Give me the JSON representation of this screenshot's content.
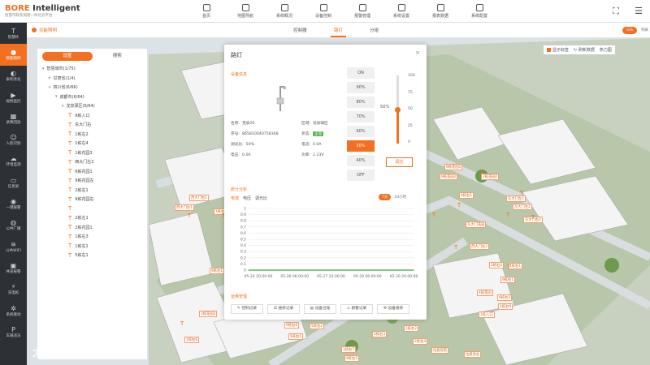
{
  "header": {
    "brand": "BORE",
    "brand2": "Intelligent",
    "subtitle": "智慧市政及照明一体化云平台",
    "nav": [
      "首页",
      "地图导航",
      "系统概况",
      "设备控制",
      "报警管理",
      "系统设置",
      "报表数据",
      "系统配置"
    ]
  },
  "sidebar": [
    {
      "label": "智慧杆",
      "icon": "T"
    },
    {
      "label": "智能照明",
      "icon": "●"
    },
    {
      "label": "泰利亮化",
      "icon": "◐"
    },
    {
      "label": "视频监控",
      "icon": "▶"
    },
    {
      "label": "录像回放",
      "icon": "▦"
    },
    {
      "label": "人脸识别",
      "icon": "☺"
    },
    {
      "label": "环境监测",
      "icon": "☁"
    },
    {
      "label": "信息屏",
      "icon": "▭"
    },
    {
      "label": "一键报警",
      "icon": "◉"
    },
    {
      "label": "公共广播",
      "icon": "◍"
    },
    {
      "label": "公共WIFI",
      "icon": "≋"
    },
    {
      "label": "井盖报警",
      "icon": "▣"
    },
    {
      "label": "充电桩",
      "icon": "⚡"
    },
    {
      "label": "系统联动",
      "icon": "✲"
    },
    {
      "label": "车辆违法",
      "icon": "P"
    }
  ],
  "subheader": {
    "crumb": "功能照明",
    "tabs": [
      "控制器",
      "路灯",
      "分组"
    ],
    "toggle_on": "GIS",
    "toggle_off": "列表"
  },
  "leftpanel": {
    "tabs": [
      "设置",
      "搜索"
    ],
    "tree": [
      {
        "label": "智慧城市(1/75)",
        "level": 0,
        "caret": "▾"
      },
      {
        "label": "甘肃省(1/4)",
        "level": 1,
        "caret": "▸"
      },
      {
        "label": "四川省(6/66)",
        "level": 1,
        "caret": "▾"
      },
      {
        "label": "成都市(6/64)",
        "level": 2,
        "caret": "▾"
      },
      {
        "label": "龙泉驿区(6/64)",
        "level": 3,
        "caret": "▾"
      },
      {
        "label": "9栋入口",
        "level": 4
      },
      {
        "label": "东大门右",
        "level": 4
      },
      {
        "label": "1栋右2",
        "level": 4
      },
      {
        "label": "1栋右4",
        "level": 4
      },
      {
        "label": "1栋花园3",
        "level": 4
      },
      {
        "label": "西大门左2",
        "level": 4
      },
      {
        "label": "6栋花园1",
        "level": 4
      },
      {
        "label": "9栋花园左",
        "level": 4
      },
      {
        "label": "2栋右1",
        "level": 4
      },
      {
        "label": "9栋花园右",
        "level": 4
      },
      {
        "label": "",
        "level": 4
      },
      {
        "label": "2栋左1",
        "level": 4
      },
      {
        "label": "2栋花园1",
        "level": 4
      },
      {
        "label": "1栋右3",
        "level": 4
      },
      {
        "label": "1栋右1",
        "level": 4
      },
      {
        "label": "5栋右1",
        "level": 4
      }
    ]
  },
  "modal": {
    "title": "路灯",
    "close": "×",
    "sec_info": "设备信息",
    "sec_stats": "统计分析",
    "sec_mgmt": "运维管理",
    "info": [
      {
        "k": "名称:",
        "v": "克泉20"
      },
      {
        "k": "区域:",
        "v": "龙泉驿区"
      },
      {
        "k": "序号:",
        "v": "865810040758368"
      },
      {
        "k": "状态:",
        "v": "正常"
      },
      {
        "k": "调光比:",
        "v": "50%"
      },
      {
        "k": "电流:",
        "v": "0.0A"
      },
      {
        "k": "电压:",
        "v": "0.0A"
      },
      {
        "k": "功率:",
        "v": "2.23V"
      }
    ],
    "controls": [
      "ON",
      "90%",
      "80%",
      "70%",
      "60%",
      "50%",
      "40%",
      "OFF"
    ],
    "active_control": "50%",
    "slider": {
      "level": 50,
      "ticks": [
        "100",
        "75",
        "50",
        "25",
        "0"
      ],
      "value_label": "50%"
    },
    "adjust_btn": "调光",
    "stat_tabs": [
      "电流",
      "电压",
      "调光比"
    ],
    "day_tabs": [
      "7天",
      "24小时"
    ],
    "mgmt_buttons": [
      "控制记录",
      "维修记录",
      "设备台账",
      "报警记录",
      "设备报修"
    ]
  },
  "chart_data": {
    "type": "line",
    "x": [
      "05-24 20:00:00",
      "05-26 06:00:00",
      "05-27 20:00:00",
      "05-29 06:00:00",
      "05-30 20:00:00"
    ],
    "yticks": [
      "1",
      "0.9",
      "0.8",
      "0.7",
      "0.6",
      "0.5",
      "0.4",
      "0.3",
      "0.2",
      "0.1",
      "0"
    ],
    "ylim": [
      0,
      1
    ],
    "series": [
      {
        "values": [
          0,
          0,
          0,
          0,
          0,
          0,
          0,
          0,
          0,
          0,
          0,
          0,
          0,
          0,
          0,
          0,
          0,
          0,
          0,
          0,
          0,
          0,
          0,
          0,
          0,
          0,
          0
        ],
        "color": "#5cb85c"
      }
    ]
  },
  "maptools": {
    "checkbox": "显示标签",
    "refresh": "刷新数据",
    "heat": "热力图"
  },
  "map_labels": [
    [
      "西大门右1",
      233,
      240
    ],
    [
      "西大门左1",
      215,
      252
    ],
    [
      "1栋右5",
      263,
      257
    ],
    [
      "9栋右1",
      258,
      330
    ],
    [
      "1栋花园2",
      245,
      383
    ],
    [
      "1栋右6",
      227,
      415
    ],
    [
      "9栋右6",
      350,
      397
    ],
    [
      "5栋右1",
      355,
      411
    ],
    [
      "5栋右2",
      381,
      398
    ],
    [
      "5栋右3",
      458,
      408
    ],
    [
      "2栋右2",
      497,
      401
    ],
    [
      "2栋右4",
      508,
      417
    ],
    [
      "1栋右7",
      420,
      427
    ],
    [
      "9栋右5",
      424,
      438
    ],
    [
      "垃圾房前",
      531,
      428
    ],
    [
      "垃圾房左",
      571,
      433
    ],
    [
      "9栋花园1",
      547,
      202
    ],
    [
      "9栋花园2",
      541,
      214
    ],
    [
      "2栋花园2",
      592,
      214
    ],
    [
      "4栋右1",
      565,
      237
    ],
    [
      "东大门左1",
      623,
      241
    ],
    [
      "东大门左2",
      631,
      251
    ],
    [
      "东大门右2",
      644,
      267
    ],
    [
      "东大门花园",
      573,
      273
    ],
    [
      "西大门右3",
      578,
      300
    ],
    [
      "1栋右2",
      602,
      323
    ],
    [
      "1栋右1",
      625,
      324
    ],
    [
      "9栋右1",
      616,
      341
    ],
    [
      "4栋花园",
      587,
      357
    ],
    [
      "1栋右9",
      613,
      374
    ],
    [
      "1栋入口",
      589,
      384
    ],
    [
      "9栋右2",
      612,
      363
    ]
  ],
  "map_pins": [
    [
      222,
      395
    ],
    [
      283,
      256
    ],
    [
      231,
      262
    ],
    [
      273,
      262
    ],
    [
      353,
      380
    ],
    [
      424,
      388
    ],
    [
      514,
      374
    ],
    [
      532,
      261
    ],
    [
      563,
      249
    ],
    [
      640,
      234
    ],
    [
      623,
      261
    ],
    [
      654,
      264
    ],
    [
      591,
      208
    ],
    [
      624,
      325
    ],
    [
      559,
      301
    ]
  ],
  "watermark": "大数据讯"
}
